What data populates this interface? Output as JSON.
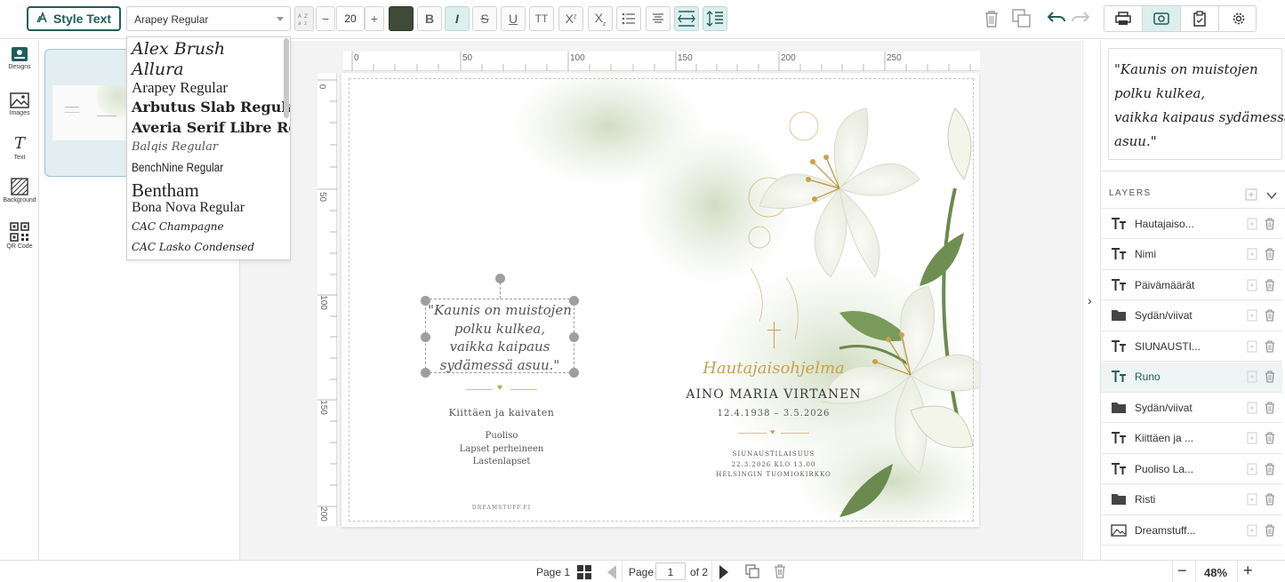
{
  "toolbar": {
    "style_text_label": "Style Text",
    "font_value": "Arapey Regular",
    "font_size": "20",
    "text_color": "#3f4a38",
    "buttons": [
      "bold",
      "italic",
      "strikethrough",
      "underline",
      "caps",
      "superscript",
      "subscript",
      "bullet-list",
      "align-center",
      "line-spacing",
      "paragraph-spacing"
    ],
    "active_buttons": [
      "italic",
      "line-spacing",
      "paragraph-spacing"
    ]
  },
  "font_list": [
    "Alex Brush",
    "Allura",
    "Arapey Regular",
    "Arbutus Slab Regular",
    "Averia Serif Libre Reg",
    "Balqis Regular",
    "BenchNine Regular",
    "Bentham",
    "Bona Nova Regular",
    "CAC Champagne",
    "CAC Lasko Condensed"
  ],
  "left_nav": [
    {
      "label": "Designs",
      "icon": "designs-icon"
    },
    {
      "label": "Images",
      "icon": "image-icon"
    },
    {
      "label": "Text",
      "icon": "text-icon"
    },
    {
      "label": "Background",
      "icon": "background-icon"
    },
    {
      "label": "QR Code",
      "icon": "qr-code-icon"
    }
  ],
  "ruler": {
    "top": [
      "0",
      "50",
      "100",
      "150",
      "200",
      "250"
    ],
    "left": [
      "0",
      "50",
      "100",
      "150",
      "200"
    ]
  },
  "card": {
    "poem": [
      "\"Kaunis on muistojen",
      "polku kulkea,",
      "vaikka kaipaus",
      "sydämessä asuu.\""
    ],
    "thanks": "Kiittäen ja kaivaten",
    "family": [
      "Puoliso",
      "Lapset perheineen",
      "Lastenlapset"
    ],
    "brand": "DREAMSTUFF.FI",
    "heading_script": "Hautajaisohjelma",
    "name": "AINO MARIA VIRTANEN",
    "dates": "12.4.1938 – 3.5.2026",
    "ceremony": [
      "SIUNAUSTILAISUUS",
      "22.3.2026 KLO 13.00",
      "HELSINGIN TUOMIOKIRKKO"
    ],
    "accent_color": "#c9a24a"
  },
  "right_panel": {
    "preview_text": "\"Kaunis on muistojen\npolku kulkea,\nvaikka kaipaus sydämessä\nasuu.\"",
    "layers_title": "LAYERS",
    "layers": [
      {
        "name": "Hautajaiso...",
        "type": "text"
      },
      {
        "name": "Nimi",
        "type": "text"
      },
      {
        "name": "Päivämäärät",
        "type": "text"
      },
      {
        "name": "Sydän/viivat",
        "type": "folder"
      },
      {
        "name": "SIUNAUSTI...",
        "type": "text"
      },
      {
        "name": "Runo",
        "type": "text",
        "selected": true
      },
      {
        "name": "Sydän/viivat",
        "type": "folder"
      },
      {
        "name": "Kiittäen ja ...",
        "type": "text"
      },
      {
        "name": "Puoliso La...",
        "type": "text"
      },
      {
        "name": "Risti",
        "type": "folder"
      },
      {
        "name": "Dreamstuff...",
        "type": "image"
      }
    ]
  },
  "bottom": {
    "page_label": "Page 1",
    "page_word": "Page",
    "page_input": "1",
    "page_of": "of 2",
    "zoom": "48%"
  },
  "colors": {
    "brand": "#1f5e5a",
    "active_bg": "#dcefed"
  }
}
